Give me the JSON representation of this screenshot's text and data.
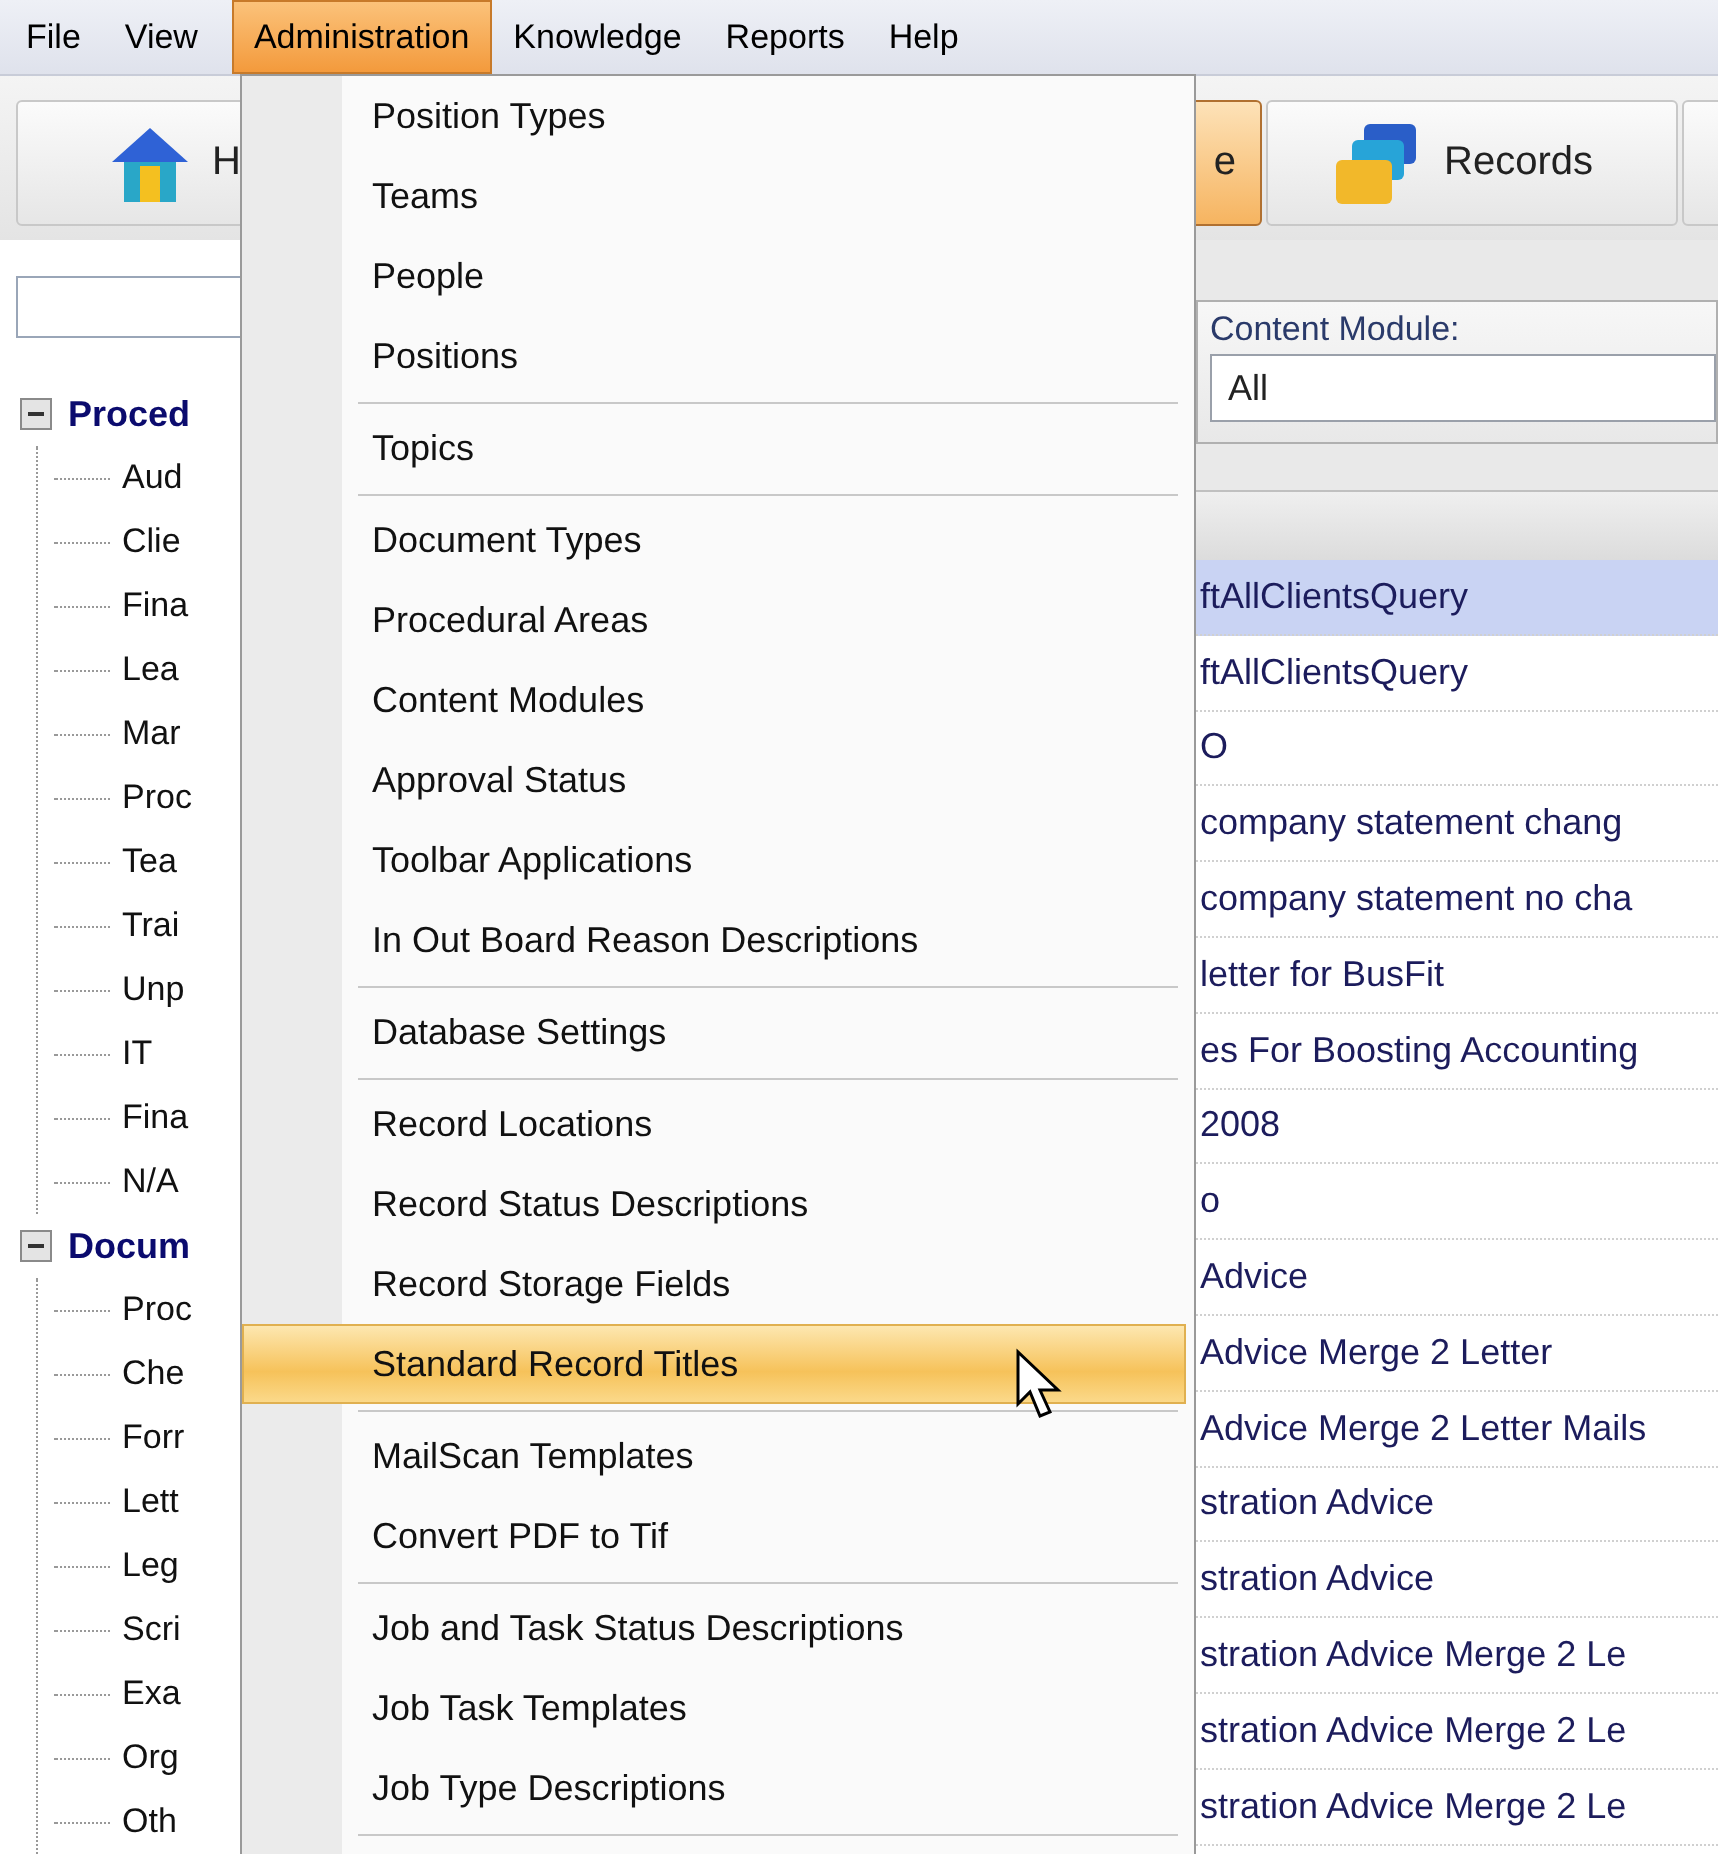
{
  "menu_bar": [
    {
      "label": "File",
      "selected": false
    },
    {
      "label": "View",
      "selected": false
    },
    {
      "label": "Administration",
      "selected": true
    },
    {
      "label": "Knowledge",
      "selected": false
    },
    {
      "label": "Reports",
      "selected": false
    },
    {
      "label": "Help",
      "selected": false
    }
  ],
  "toolbar": [
    {
      "kind": "home",
      "label": "H",
      "selected": false
    },
    {
      "kind": "plain",
      "label": "e",
      "selected": true
    },
    {
      "kind": "records",
      "label": "Records",
      "selected": false
    },
    {
      "kind": "blank",
      "selected": false
    }
  ],
  "tree": [
    {
      "label": "Proced",
      "expanded": true,
      "children": [
        {
          "label": "Aud"
        },
        {
          "label": "Clie"
        },
        {
          "label": "Fina"
        },
        {
          "label": "Lea"
        },
        {
          "label": "Mar"
        },
        {
          "label": "Proc"
        },
        {
          "label": "Tea"
        },
        {
          "label": "Trai"
        },
        {
          "label": "Unp"
        },
        {
          "label": "IT"
        },
        {
          "label": "Fina"
        },
        {
          "label": "N/A"
        }
      ]
    },
    {
      "label": "Docum",
      "expanded": true,
      "children": [
        {
          "label": "Proc"
        },
        {
          "label": "Che"
        },
        {
          "label": "Forr"
        },
        {
          "label": "Lett"
        },
        {
          "label": "Leg"
        },
        {
          "label": "Scri"
        },
        {
          "label": "Exa"
        },
        {
          "label": "Org"
        },
        {
          "label": "Oth"
        }
      ]
    }
  ],
  "content_module": {
    "label": "Content Module:",
    "value": "All"
  },
  "grid": {
    "rows": [
      {
        "text": "ftAllClientsQuery",
        "selected": true
      },
      {
        "text": "ftAllClientsQuery",
        "selected": false
      },
      {
        "text": "O",
        "selected": false
      },
      {
        "text": "company statement chang",
        "selected": false
      },
      {
        "text": "company statement no cha",
        "selected": false
      },
      {
        "text": "letter for BusFit",
        "selected": false
      },
      {
        "text": "es For Boosting Accounting",
        "selected": false
      },
      {
        "text": "2008",
        "selected": false
      },
      {
        "text": "o",
        "selected": false
      },
      {
        "text": "Advice",
        "selected": false
      },
      {
        "text": "Advice Merge 2 Letter",
        "selected": false
      },
      {
        "text": "Advice Merge 2 Letter Mails",
        "selected": false
      },
      {
        "text": "stration Advice",
        "selected": false
      },
      {
        "text": "stration Advice",
        "selected": false
      },
      {
        "text": "stration Advice Merge 2 Le",
        "selected": false
      },
      {
        "text": "stration Advice Merge 2 Le",
        "selected": false
      },
      {
        "text": "stration Advice Merge 2 Le",
        "selected": false
      }
    ]
  },
  "menu": {
    "groups": [
      [
        {
          "label": "Position Types",
          "selected": false
        },
        {
          "label": "Teams",
          "selected": false
        },
        {
          "label": "People",
          "selected": false
        },
        {
          "label": "Positions",
          "selected": false
        }
      ],
      [
        {
          "label": "Topics",
          "selected": false
        }
      ],
      [
        {
          "label": "Document Types",
          "selected": false
        },
        {
          "label": "Procedural Areas",
          "selected": false
        },
        {
          "label": "Content Modules",
          "selected": false
        },
        {
          "label": "Approval Status",
          "selected": false
        },
        {
          "label": "Toolbar Applications",
          "selected": false
        },
        {
          "label": "In Out Board Reason Descriptions",
          "selected": false
        }
      ],
      [
        {
          "label": "Database Settings",
          "selected": false
        }
      ],
      [
        {
          "label": "Record Locations",
          "selected": false
        },
        {
          "label": "Record Status Descriptions",
          "selected": false
        },
        {
          "label": "Record Storage Fields",
          "selected": false
        },
        {
          "label": "Standard Record Titles",
          "selected": true
        }
      ],
      [
        {
          "label": "MailScan Templates",
          "selected": false
        },
        {
          "label": "Convert PDF to Tif",
          "selected": false
        }
      ],
      [
        {
          "label": "Job and Task Status Descriptions",
          "selected": false
        },
        {
          "label": "Job Task Templates",
          "selected": false
        },
        {
          "label": "Job Type Descriptions",
          "selected": false
        }
      ]
    ]
  }
}
